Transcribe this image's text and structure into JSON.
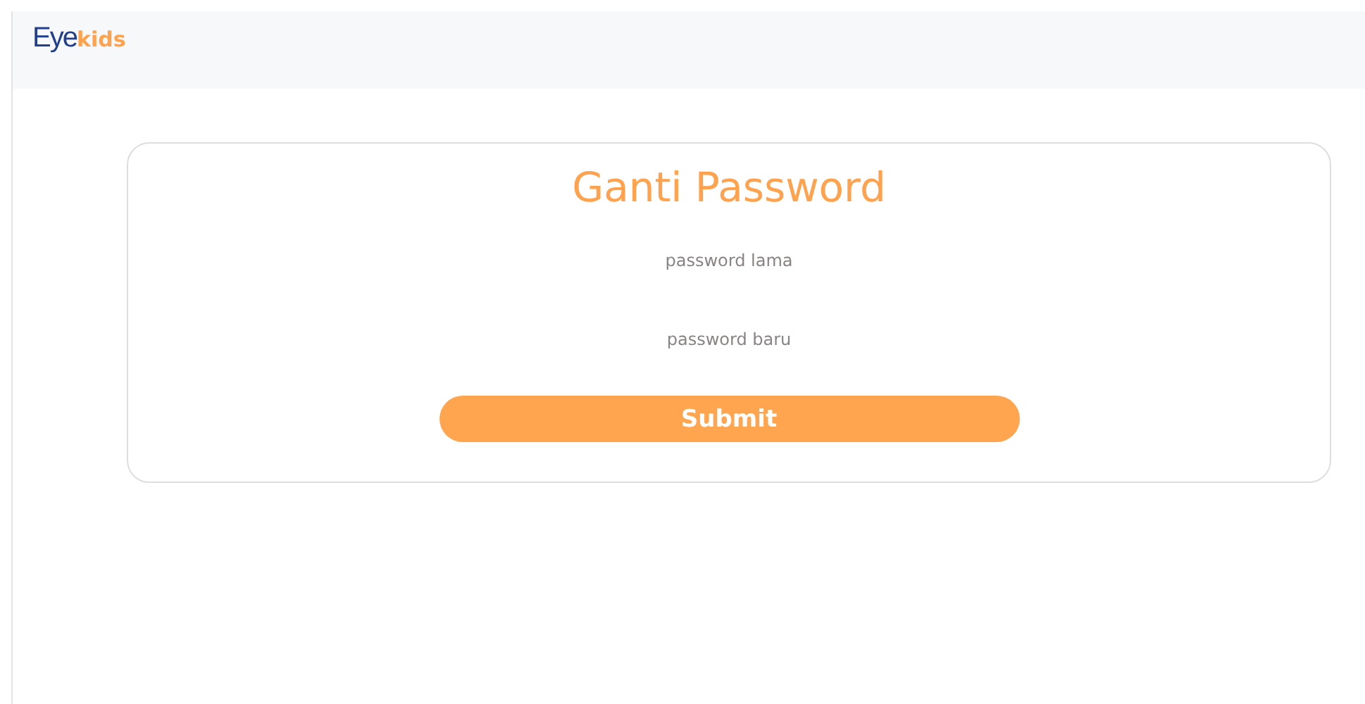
{
  "header": {
    "logo": {
      "main": "Eye",
      "suffix": "kids"
    }
  },
  "form": {
    "title": "Ganti Password",
    "fields": [
      {
        "placeholder": "password lama"
      },
      {
        "placeholder": "password baru"
      }
    ],
    "submit": "Submit"
  }
}
